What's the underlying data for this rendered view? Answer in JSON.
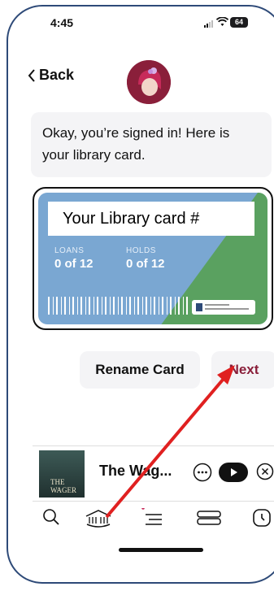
{
  "status_bar": {
    "time": "4:45",
    "battery": "64"
  },
  "header": {
    "back_label": "Back"
  },
  "message": {
    "text": "Okay, you’re signed in! Here is your library card."
  },
  "card": {
    "number_label": "Your Library card #",
    "loans": {
      "label": "LOANS",
      "value": "0 of 12"
    },
    "holds": {
      "label": "HOLDS",
      "value": "0 of 12"
    }
  },
  "actions": {
    "rename_label": "Rename Card",
    "next_label": "Next"
  },
  "mini_player": {
    "title": "The Wag...",
    "cover_text": "THE WAGER"
  },
  "colors": {
    "accent": "#8a1f3a",
    "card_blue": "#7aa7d2",
    "card_green": "#5aa160",
    "annotation_arrow": "#e02020"
  },
  "tabs": [
    "search-icon",
    "library-icon",
    "menu-icon",
    "shelf-icon",
    "clock-icon"
  ]
}
